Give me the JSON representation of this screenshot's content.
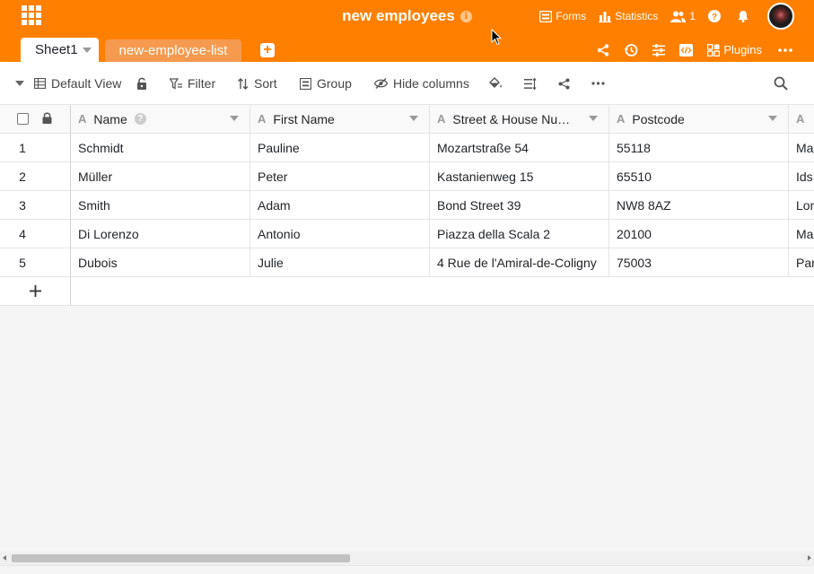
{
  "header": {
    "title": "new employees",
    "actions": {
      "forms": "Forms",
      "statistics": "Statistics",
      "collaborators_count": "1"
    }
  },
  "tabs": {
    "active": "Sheet1",
    "inactive": "new-employee-list",
    "plugins": "Plugins"
  },
  "toolbar": {
    "view": "Default View",
    "filter": "Filter",
    "sort": "Sort",
    "group": "Group",
    "hide_columns": "Hide columns"
  },
  "table": {
    "columns": [
      "Name",
      "First Name",
      "Street & House Nu…",
      "Postcode",
      ""
    ],
    "rows": [
      {
        "num": "1",
        "name": "Schmidt",
        "first": "Pauline",
        "street": "Mozartstraße 54",
        "postcode": "55118",
        "city": "Ma"
      },
      {
        "num": "2",
        "name": "Müller",
        "first": "Peter",
        "street": "Kastanienweg 15",
        "postcode": "65510",
        "city": "Ids"
      },
      {
        "num": "3",
        "name": "Smith",
        "first": "Adam",
        "street": "Bond Street 39",
        "postcode": "NW8 8AZ",
        "city": "Lon"
      },
      {
        "num": "4",
        "name": "Di Lorenzo",
        "first": "Antonio",
        "street": "Piazza della Scala 2",
        "postcode": "20100",
        "city": "Ma"
      },
      {
        "num": "5",
        "name": "Dubois",
        "first": "Julie",
        "street": "4 Rue de l'Amiral-de-Coligny",
        "postcode": "75003",
        "city": "Par"
      }
    ]
  },
  "colors": {
    "brand": "#ff8000",
    "inactive_tab": "#f59a4e"
  }
}
